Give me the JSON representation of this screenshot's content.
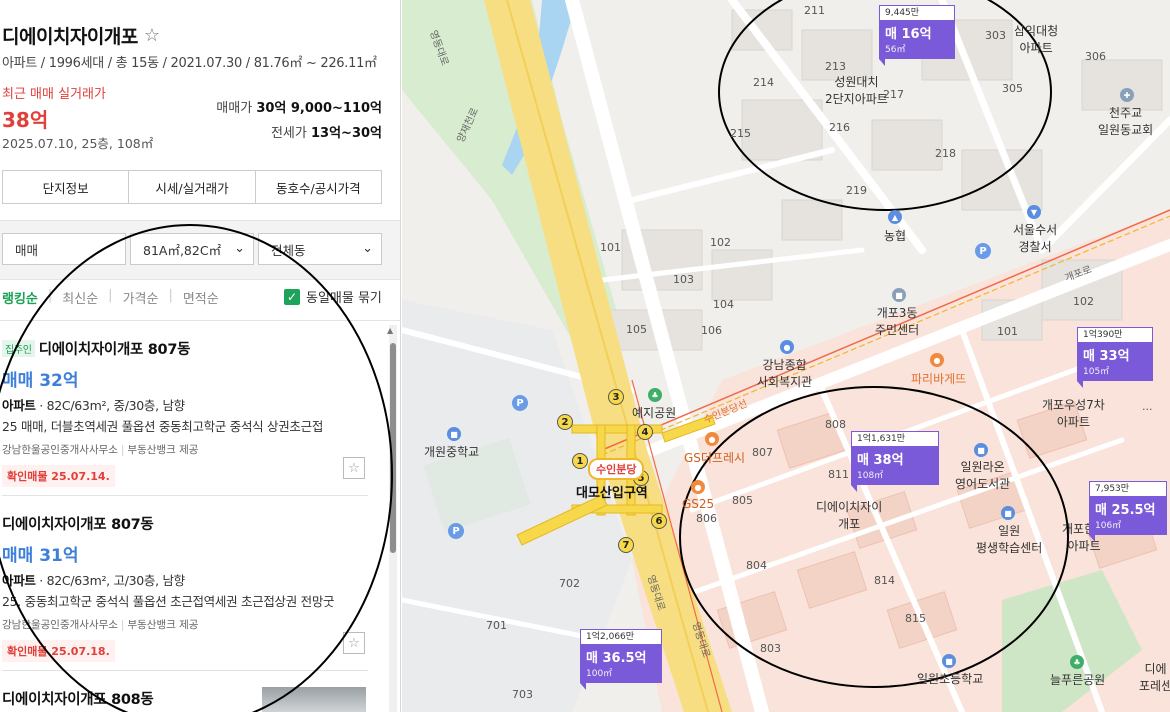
{
  "complex": {
    "title": "디에이치자이개포",
    "meta": "아파트 / 1996세대 / 총 15동 / 2021.07.30 / 81.76㎡ ~ 226.11㎡",
    "recent_label": "최근 매매 실거래가",
    "recent_price": "38억",
    "recent_date": "2025.07.10, 25층, 108㎡",
    "sale_label": "매매가",
    "sale_range": "30억 9,000~110억",
    "jeonse_label": "전세가",
    "jeonse_range": "13억~30억"
  },
  "tabs": [
    "단지정보",
    "시세/실거래가",
    "동호수/공시가격"
  ],
  "filters": {
    "deal": "매매",
    "area": "81A㎡,82C㎡",
    "dong": "전체동"
  },
  "sort": {
    "options": [
      "랭킹순",
      "최신순",
      "가격순",
      "면적순"
    ],
    "group_label": "동일매물 묶기"
  },
  "listings": [
    {
      "badge": "집주인",
      "title": "디에이치자이개포 807동",
      "price": "매매 32억",
      "spec_type": "아파트",
      "spec": " · 82C/63m², 중/30층, 남향",
      "desc": "25 매매, 더블초역세권 풀옵션 중동최고학군 중석식 상권초근접",
      "agent": "강남한울공인중개사사무소",
      "provider": "부동산뱅크 제공",
      "confirm": "확인매물 25.07.14."
    },
    {
      "badge": "",
      "title": "디에이치자이개포 807동",
      "price": "매매 31억",
      "spec_type": "아파트",
      "spec": " · 82C/63m², 고/30층, 남향",
      "desc": "25. 중동최고학군 중석식 풀옵션 초근접역세권 초근접상권 전망굿",
      "agent": "강남한울공인중개사사무소",
      "provider": "부동산뱅크 제공",
      "confirm": "확인매물 25.07.18."
    },
    {
      "badge": "",
      "title": "디에이치자이개포 808동",
      "price": "",
      "spec_type": "",
      "spec": "",
      "desc": "",
      "agent": "",
      "provider": "",
      "confirm": ""
    }
  ],
  "map": {
    "markers": [
      {
        "count": "9,445만",
        "price": "매 16억",
        "area": "56㎡"
      },
      {
        "count": "1억390만",
        "price": "매 33억",
        "area": "105㎡"
      },
      {
        "count": "1억1,631만",
        "price": "매 38억",
        "area": "108㎡"
      },
      {
        "count": "7,953만",
        "price": "매 25.5억",
        "area": "106㎡"
      },
      {
        "count": "1억2,066만",
        "price": "매 36.5억",
        "area": "100㎡"
      }
    ],
    "labels": {
      "apt_seongwon": "성원대치\n2단지아파트",
      "apt_daechi": "삼익대청\n아파트",
      "church": "천주교\n일원동교회",
      "nonghyup": "농협",
      "police": "서울수서\n경찰서",
      "center3": "개포3동\n주민센터",
      "welfare": "강남종합\n사회복지관",
      "paris": "파리바게뜨",
      "woosung": "개포우성7차\n아파트",
      "yeji": "예지공원",
      "gaewon_school": "개원중학교",
      "gs_fresh": "GS더프레시",
      "gs25": "GS25",
      "library": "일원라온\n영어도서관",
      "learning": "일원\n평생학습센터",
      "dhxi": "디에이치자이\n개포",
      "station": "수인분당",
      "station_area": "대모산입구역",
      "gaepo_apt": "개포한신\n아파트",
      "neulpureun": "늘푸른공원",
      "ilwon_school": "일원초등학교",
      "dh_forest": "디에\n포레센",
      "road_yangjae": "양재천로",
      "road_yeongdong": "영동대로",
      "road_gaepo": "개포로",
      "road_suin": "수인분당선"
    }
  }
}
